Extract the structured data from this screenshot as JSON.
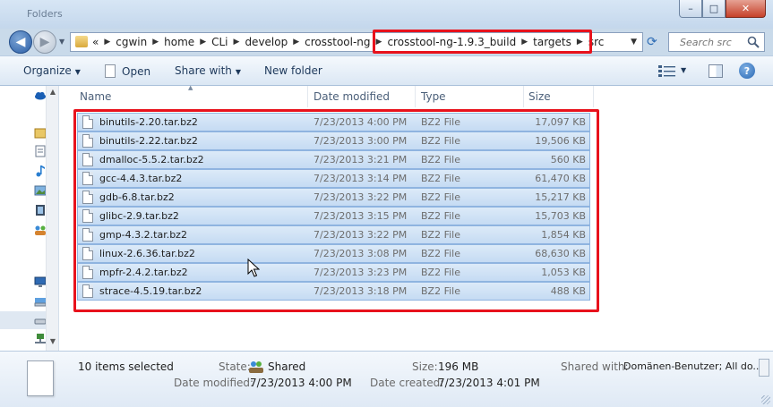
{
  "window": {
    "title": "Folders",
    "controls": {
      "minimize": "–",
      "maximize": "□",
      "close": "✕"
    }
  },
  "nav": {
    "back_icon": "back-arrow-icon",
    "forward_icon": "forward-arrow-icon",
    "overflow": "«",
    "breadcrumbs": [
      "cgwin",
      "home",
      "CLi",
      "develop",
      "crosstool-ng",
      "crosstool-ng-1.9.3_build",
      "targets",
      "src"
    ],
    "search_placeholder": "Search src"
  },
  "toolbar": {
    "organize": "Organize",
    "open": "Open",
    "share_with": "Share with",
    "new_folder": "New folder"
  },
  "columns": [
    "Name",
    "Date modified",
    "Type",
    "Size"
  ],
  "files": [
    {
      "name": "binutils-2.20.tar.bz2",
      "date": "7/23/2013 4:00 PM",
      "type": "BZ2 File",
      "size": "17,097 KB"
    },
    {
      "name": "binutils-2.22.tar.bz2",
      "date": "7/23/2013 3:00 PM",
      "type": "BZ2 File",
      "size": "19,506 KB"
    },
    {
      "name": "dmalloc-5.5.2.tar.bz2",
      "date": "7/23/2013 3:21 PM",
      "type": "BZ2 File",
      "size": "560 KB"
    },
    {
      "name": "gcc-4.4.3.tar.bz2",
      "date": "7/23/2013 3:14 PM",
      "type": "BZ2 File",
      "size": "61,470 KB"
    },
    {
      "name": "gdb-6.8.tar.bz2",
      "date": "7/23/2013 3:22 PM",
      "type": "BZ2 File",
      "size": "15,217 KB"
    },
    {
      "name": "glibc-2.9.tar.bz2",
      "date": "7/23/2013 3:15 PM",
      "type": "BZ2 File",
      "size": "15,703 KB"
    },
    {
      "name": "gmp-4.3.2.tar.bz2",
      "date": "7/23/2013 3:22 PM",
      "type": "BZ2 File",
      "size": "1,854 KB"
    },
    {
      "name": "linux-2.6.36.tar.bz2",
      "date": "7/23/2013 3:08 PM",
      "type": "BZ2 File",
      "size": "68,630 KB"
    },
    {
      "name": "mpfr-2.4.2.tar.bz2",
      "date": "7/23/2013 3:23 PM",
      "type": "BZ2 File",
      "size": "1,053 KB"
    },
    {
      "name": "strace-4.5.19.tar.bz2",
      "date": "7/23/2013 3:18 PM",
      "type": "BZ2 File",
      "size": "488 KB"
    }
  ],
  "details": {
    "selection": "10 items selected",
    "state_label": "State:",
    "state_value": "Shared",
    "size_label": "Size:",
    "size_value": "196 MB",
    "shared_label": "Shared with:",
    "shared_value": "Domänen-Benutzer; All do...",
    "modified_label": "Date modified:",
    "modified_value": "7/23/2013 4:00 PM",
    "created_label": "Date created:",
    "created_value": "7/23/2013 4:01 PM"
  },
  "colors": {
    "annotation": "#e8121c",
    "selection": "#c5dbf3",
    "accent": "#2a5ea6"
  }
}
